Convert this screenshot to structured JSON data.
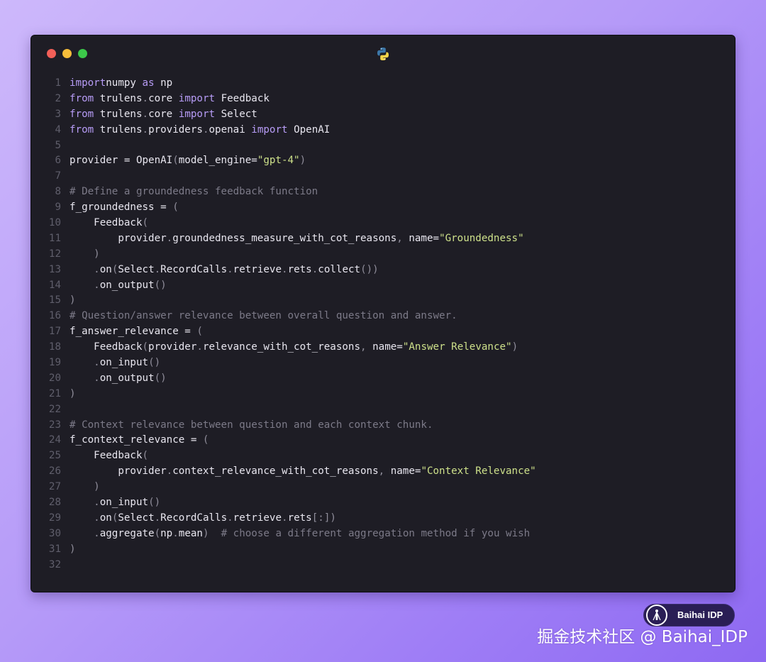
{
  "window": {
    "traffic_lights": {
      "close": "#f25f58",
      "minimize": "#f6bd3a",
      "zoom": "#3cc84a"
    },
    "title_icon": "python-logo-icon"
  },
  "code": {
    "language": "python",
    "colors": {
      "background": "#1e1d25",
      "text": "#e8e6ef",
      "keyword": "#b79cf6",
      "string": "#cde08a",
      "comment": "#7c7a88",
      "line_number": "#5f5e6b"
    },
    "lines": [
      {
        "n": "1",
        "tokens": [
          [
            "kw",
            "import"
          ],
          [
            "",
            "numpy "
          ],
          [
            "kw",
            "as"
          ],
          [
            "",
            " np"
          ]
        ]
      },
      {
        "n": "2",
        "tokens": [
          [
            "kw",
            "from"
          ],
          [
            "",
            " trulens"
          ],
          [
            "pn",
            "."
          ],
          [
            "",
            "core "
          ],
          [
            "kw",
            "import"
          ],
          [
            "",
            " Feedback"
          ]
        ]
      },
      {
        "n": "3",
        "tokens": [
          [
            "kw",
            "from"
          ],
          [
            "",
            " trulens"
          ],
          [
            "pn",
            "."
          ],
          [
            "",
            "core "
          ],
          [
            "kw",
            "import"
          ],
          [
            "",
            " Select"
          ]
        ]
      },
      {
        "n": "4",
        "tokens": [
          [
            "kw",
            "from"
          ],
          [
            "",
            " trulens"
          ],
          [
            "pn",
            "."
          ],
          [
            "",
            "providers"
          ],
          [
            "pn",
            "."
          ],
          [
            "",
            "openai "
          ],
          [
            "kw",
            "import"
          ],
          [
            "",
            " OpenAI"
          ]
        ]
      },
      {
        "n": "5",
        "tokens": []
      },
      {
        "n": "6",
        "tokens": [
          [
            "",
            "provider = OpenAI"
          ],
          [
            "pn",
            "("
          ],
          [
            "",
            "model_engine="
          ],
          [
            "str",
            "\"gpt-4\""
          ],
          [
            "pn",
            ")"
          ]
        ]
      },
      {
        "n": "7",
        "tokens": []
      },
      {
        "n": "8",
        "tokens": [
          [
            "cm",
            "# Define a groundedness feedback function"
          ]
        ]
      },
      {
        "n": "9",
        "tokens": [
          [
            "",
            "f_groundedness = "
          ],
          [
            "pn",
            "("
          ]
        ]
      },
      {
        "n": "10",
        "tokens": [
          [
            "",
            "    Feedback"
          ],
          [
            "pn",
            "("
          ]
        ]
      },
      {
        "n": "11",
        "tokens": [
          [
            "",
            "        provider"
          ],
          [
            "pn",
            "."
          ],
          [
            "",
            "groundedness_measure_with_cot_reasons"
          ],
          [
            "pn",
            ","
          ],
          [
            "",
            " name="
          ],
          [
            "str",
            "\"Groundedness\""
          ]
        ]
      },
      {
        "n": "12",
        "tokens": [
          [
            "pn",
            "    )"
          ]
        ]
      },
      {
        "n": "13",
        "tokens": [
          [
            "pn",
            "    ."
          ],
          [
            "",
            "on"
          ],
          [
            "pn",
            "("
          ],
          [
            "",
            "Select"
          ],
          [
            "pn",
            "."
          ],
          [
            "",
            "RecordCalls"
          ],
          [
            "pn",
            "."
          ],
          [
            "",
            "retrieve"
          ],
          [
            "pn",
            "."
          ],
          [
            "",
            "rets"
          ],
          [
            "pn",
            "."
          ],
          [
            "",
            "collect"
          ],
          [
            "pn",
            "())"
          ]
        ]
      },
      {
        "n": "14",
        "tokens": [
          [
            "pn",
            "    ."
          ],
          [
            "",
            "on_output"
          ],
          [
            "pn",
            "()"
          ]
        ]
      },
      {
        "n": "15",
        "tokens": [
          [
            "pn",
            ")"
          ]
        ]
      },
      {
        "n": "16",
        "tokens": [
          [
            "cm",
            "# Question/answer relevance between overall question and answer."
          ]
        ]
      },
      {
        "n": "17",
        "tokens": [
          [
            "",
            "f_answer_relevance = "
          ],
          [
            "pn",
            "("
          ]
        ]
      },
      {
        "n": "18",
        "tokens": [
          [
            "",
            "    Feedback"
          ],
          [
            "pn",
            "("
          ],
          [
            "",
            "provider"
          ],
          [
            "pn",
            "."
          ],
          [
            "",
            "relevance_with_cot_reasons"
          ],
          [
            "pn",
            ","
          ],
          [
            "",
            " name="
          ],
          [
            "str",
            "\"Answer Relevance\""
          ],
          [
            "pn",
            ")"
          ]
        ]
      },
      {
        "n": "19",
        "tokens": [
          [
            "pn",
            "    ."
          ],
          [
            "",
            "on_input"
          ],
          [
            "pn",
            "()"
          ]
        ]
      },
      {
        "n": "20",
        "tokens": [
          [
            "pn",
            "    ."
          ],
          [
            "",
            "on_output"
          ],
          [
            "pn",
            "()"
          ]
        ]
      },
      {
        "n": "21",
        "tokens": [
          [
            "pn",
            ")"
          ]
        ]
      },
      {
        "n": "22",
        "tokens": []
      },
      {
        "n": "23",
        "tokens": [
          [
            "cm",
            "# Context relevance between question and each context chunk."
          ]
        ]
      },
      {
        "n": "24",
        "tokens": [
          [
            "",
            "f_context_relevance = "
          ],
          [
            "pn",
            "("
          ]
        ]
      },
      {
        "n": "25",
        "tokens": [
          [
            "",
            "    Feedback"
          ],
          [
            "pn",
            "("
          ]
        ]
      },
      {
        "n": "26",
        "tokens": [
          [
            "",
            "        provider"
          ],
          [
            "pn",
            "."
          ],
          [
            "",
            "context_relevance_with_cot_reasons"
          ],
          [
            "pn",
            ","
          ],
          [
            "",
            " name="
          ],
          [
            "str",
            "\"Context Relevance\""
          ]
        ]
      },
      {
        "n": "27",
        "tokens": [
          [
            "pn",
            "    )"
          ]
        ]
      },
      {
        "n": "28",
        "tokens": [
          [
            "pn",
            "    ."
          ],
          [
            "",
            "on_input"
          ],
          [
            "pn",
            "()"
          ]
        ]
      },
      {
        "n": "29",
        "tokens": [
          [
            "pn",
            "    ."
          ],
          [
            "",
            "on"
          ],
          [
            "pn",
            "("
          ],
          [
            "",
            "Select"
          ],
          [
            "pn",
            "."
          ],
          [
            "",
            "RecordCalls"
          ],
          [
            "pn",
            "."
          ],
          [
            "",
            "retrieve"
          ],
          [
            "pn",
            "."
          ],
          [
            "",
            "rets"
          ],
          [
            "pn",
            "[:])"
          ]
        ]
      },
      {
        "n": "30",
        "tokens": [
          [
            "pn",
            "    ."
          ],
          [
            "",
            "aggregate"
          ],
          [
            "pn",
            "("
          ],
          [
            "",
            "np"
          ],
          [
            "pn",
            "."
          ],
          [
            "",
            "mean"
          ],
          [
            "pn",
            ")"
          ],
          [
            "",
            "  "
          ],
          [
            "cm",
            "# choose a different aggregation method if you wish"
          ]
        ]
      },
      {
        "n": "31",
        "tokens": [
          [
            "pn",
            ")"
          ]
        ]
      },
      {
        "n": "32",
        "tokens": []
      }
    ]
  },
  "badge": {
    "label": "Baihai IDP",
    "icon": "baihai-logo-icon"
  },
  "watermark": {
    "text": "掘金技术社区 @ Baihai_IDP"
  }
}
